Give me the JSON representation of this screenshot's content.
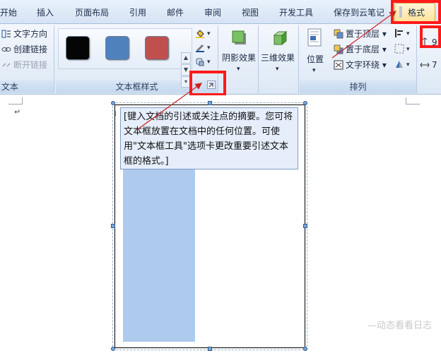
{
  "tabs": [
    {
      "id": "home",
      "label": "开始"
    },
    {
      "id": "insert",
      "label": "插入"
    },
    {
      "id": "layout",
      "label": "页面布局"
    },
    {
      "id": "references",
      "label": "引用"
    },
    {
      "id": "mailings",
      "label": "邮件"
    },
    {
      "id": "review",
      "label": "审阅"
    },
    {
      "id": "view",
      "label": "视图"
    },
    {
      "id": "developer",
      "label": "开发工具"
    },
    {
      "id": "cloud",
      "label": "保存到云笔记"
    },
    {
      "id": "format",
      "label": "格式"
    }
  ],
  "ribbon": {
    "text_group": {
      "label": "文本",
      "direction": "文字方向",
      "create_link": "创建链接",
      "break_link": "断开链接"
    },
    "textbox_styles_group": {
      "label": "文本框样式",
      "swatch_colors": [
        "#050505",
        "#4f81bd",
        "#c0504d"
      ]
    },
    "shadow": {
      "label": "阴影效果"
    },
    "threed": {
      "label": "三维效果"
    },
    "arrange_group": {
      "label": "排列",
      "position": "位置",
      "bring_front": "置于顶层",
      "send_back": "置于底层",
      "wrap": "文字环绕"
    },
    "size_group": {
      "value1": "9",
      "value2": "7"
    }
  },
  "document": {
    "quote_text": "[键入文档的引述或关注点的摘要。您可将文本框放置在文档中的任何位置。可使用\"文本框工具\"选项卡更改重要引述文本框的格式。]",
    "paragraph_mark": "↵"
  },
  "colors": {
    "highlight": "#ff1a1a",
    "arrow": "#cc1f1f",
    "fill_blue": "#aecbee"
  },
  "watermark": "—动态看看日志"
}
